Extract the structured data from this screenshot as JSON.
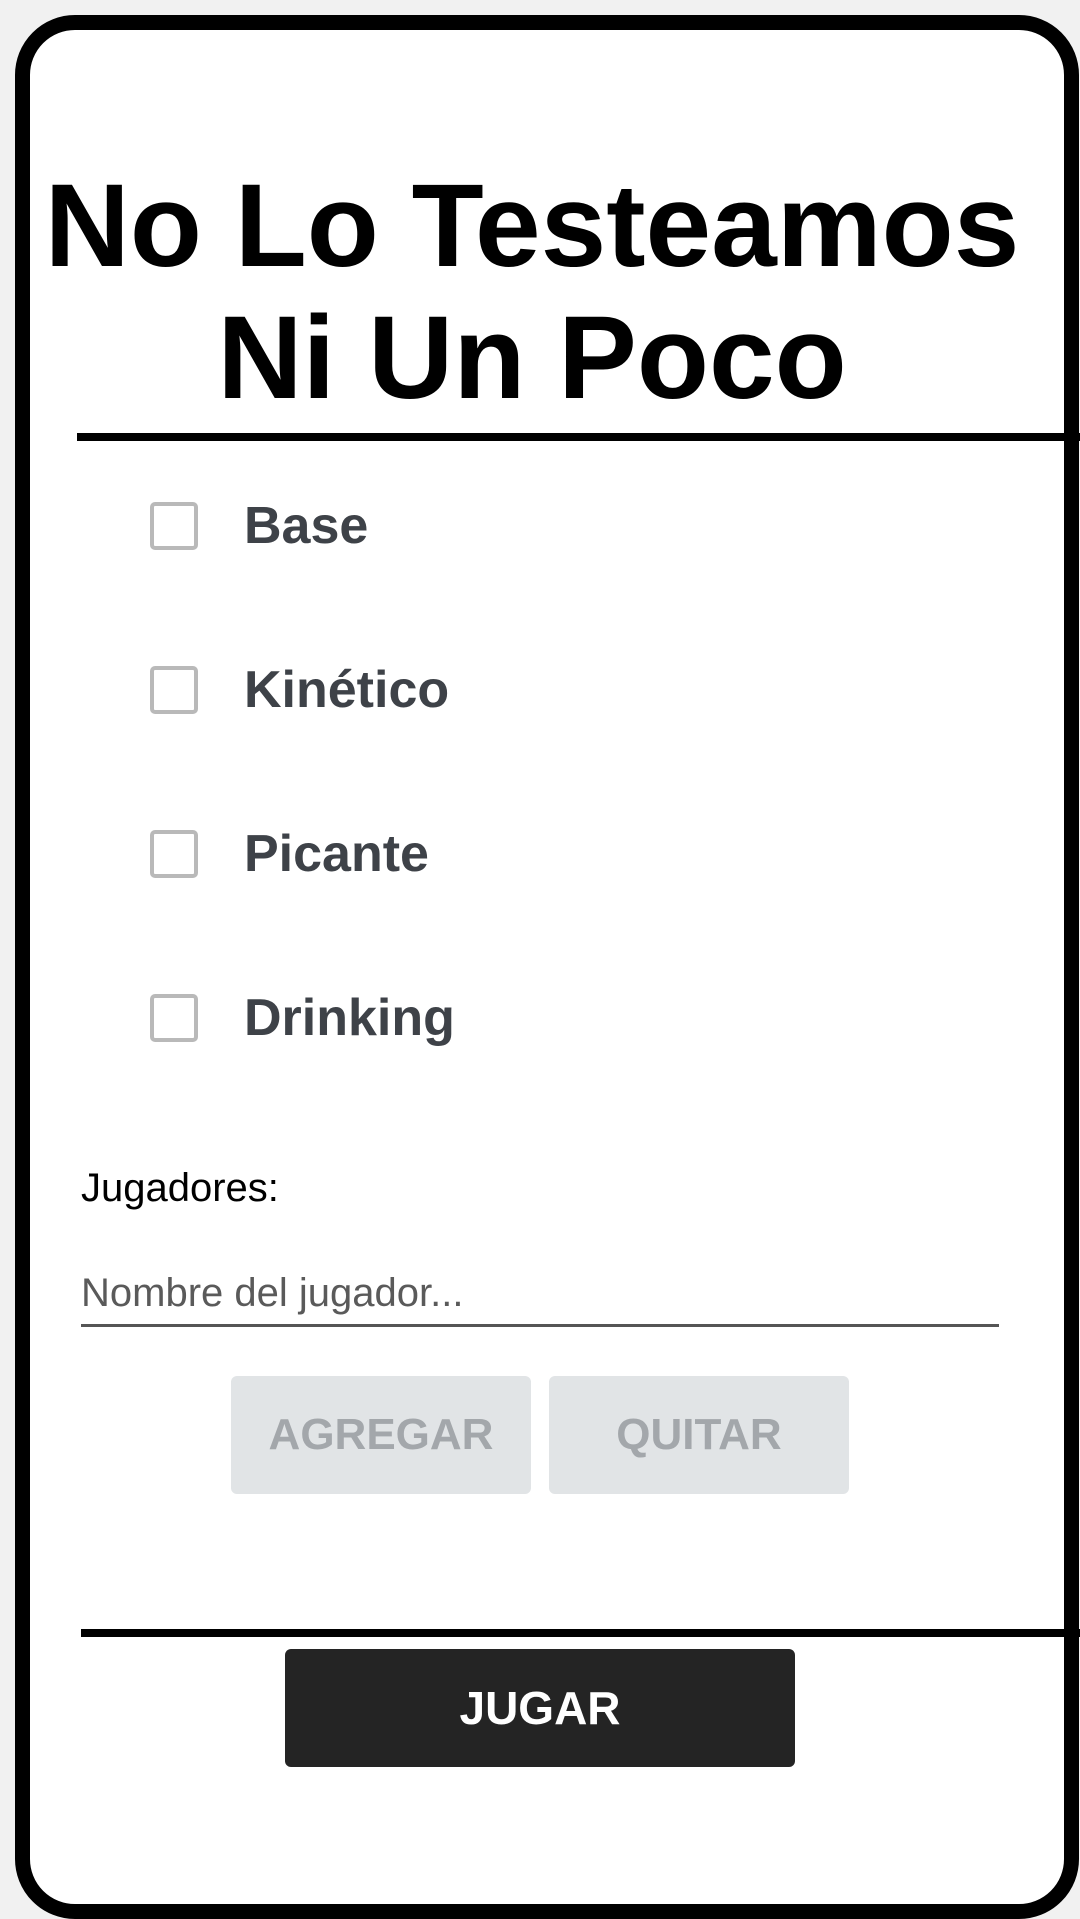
{
  "title": {
    "line1": "No Lo Testeamos",
    "line2": "Ni Un Poco"
  },
  "options": [
    {
      "label": "Base",
      "checked": false
    },
    {
      "label": "Kinético",
      "checked": false
    },
    {
      "label": "Picante",
      "checked": false
    },
    {
      "label": "Drinking",
      "checked": false
    }
  ],
  "players": {
    "label": "Jugadores:",
    "input_value": "",
    "input_placeholder": "Nombre del jugador...",
    "add_label": "AGREGAR",
    "remove_label": "QUITAR"
  },
  "play_label": "JUGAR"
}
